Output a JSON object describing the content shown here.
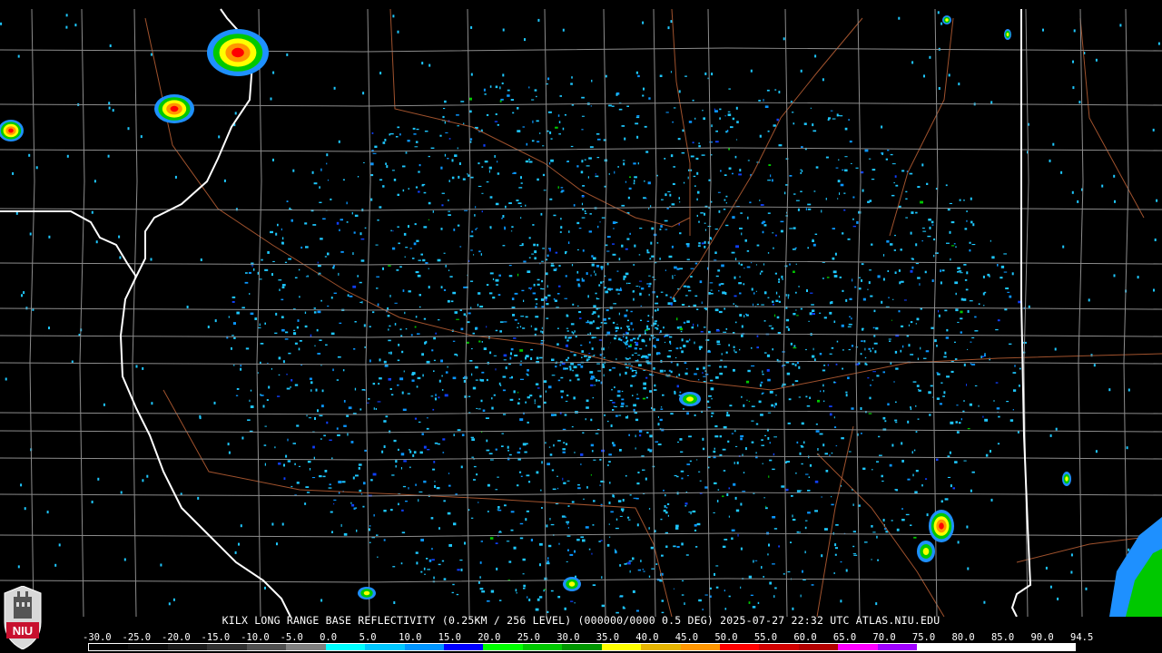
{
  "caption": "KILX LONG RANGE BASE REFLECTIVITY (0.25KM / 256 LEVEL) (000000/0000 0.5 DEG) 2025-07-27 22:32 UTC  ATLAS.NIU.EDU",
  "logo": {
    "text": "NIU",
    "bg": "#c8102e"
  },
  "colorscale": {
    "labels": [
      "-30.0",
      "-25.0",
      "-20.0",
      "-15.0",
      "-10.0",
      "-5.0",
      "0.0",
      "5.0",
      "10.0",
      "15.0",
      "20.0",
      "25.0",
      "30.0",
      "35.0",
      "40.0",
      "45.0",
      "50.0",
      "55.0",
      "60.0",
      "65.0",
      "70.0",
      "75.0",
      "80.0",
      "85.0",
      "90.0",
      "94.5"
    ],
    "colors": [
      "#000000",
      "#0a0a0a",
      "#1a1a1a",
      "#303030",
      "#505050",
      "#808080",
      "#00ffff",
      "#00c8ff",
      "#0096ff",
      "#0000ff",
      "#00ff00",
      "#00c800",
      "#009600",
      "#ffff00",
      "#e6b400",
      "#ff9600",
      "#ff0000",
      "#d20000",
      "#b40000",
      "#ff00ff",
      "#a000ff",
      "#ffffff",
      "#ffffff",
      "#ffffff",
      "#ffffff"
    ]
  },
  "colors": {
    "county_lines": "#8c8c8c",
    "state_lines": "#ffffff",
    "roads": "#a0522d",
    "echo_light": "#1ec8ff"
  }
}
